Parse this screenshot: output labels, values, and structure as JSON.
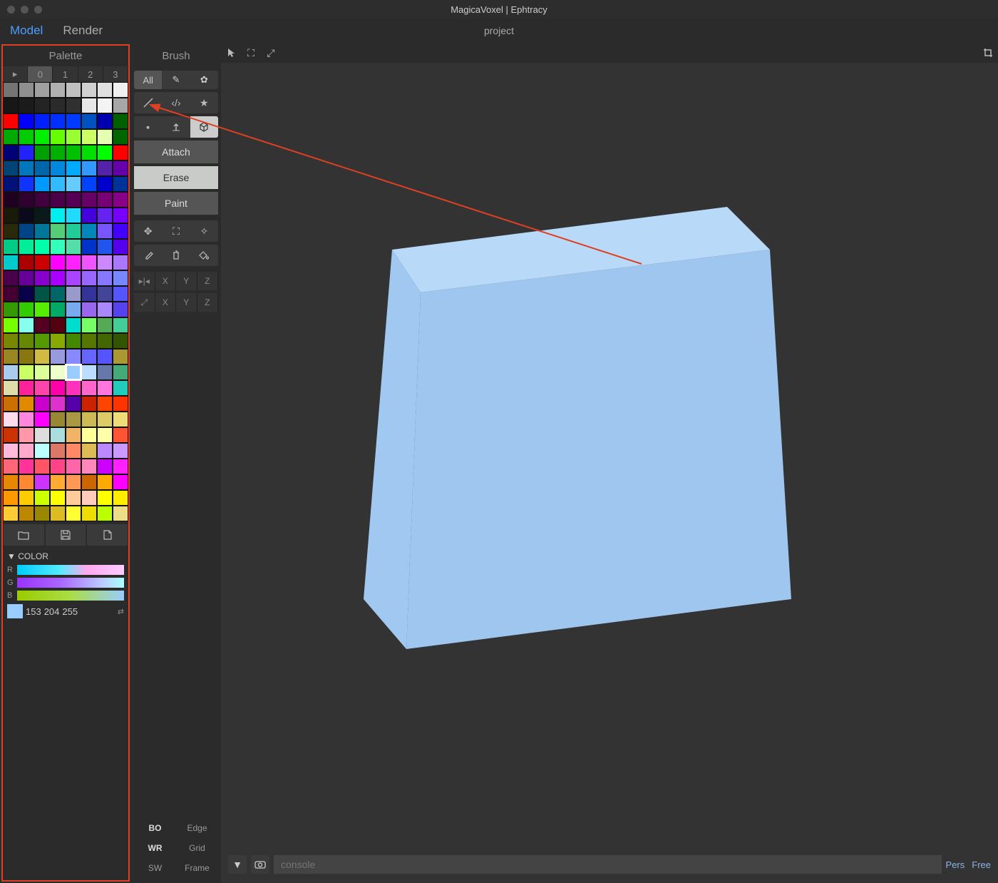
{
  "window": {
    "title": "MagicaVoxel | Ephtracy"
  },
  "menubar": {
    "tabs": [
      "Model",
      "Render"
    ],
    "active": 0,
    "project": "project"
  },
  "palette": {
    "title": "Palette",
    "tabs": [
      "▸",
      "0",
      "1",
      "2",
      "3"
    ],
    "active_tab": 1,
    "swatches": [
      "#747474",
      "#8f8f8f",
      "#a0a0a0",
      "#b0b0b0",
      "#c0c0c0",
      "#d0d0d0",
      "#e0e0e0",
      "#f0f0f0",
      "#171717",
      "#1b1b1b",
      "#242424",
      "#2a2a2a",
      "#303030",
      "#e7e7e7",
      "#f4f4f4",
      "#a7a7a7",
      "#ff0000",
      "#0000ff",
      "#0020ff",
      "#002fff",
      "#003aff",
      "#0052c0",
      "#0000b0",
      "#006000",
      "#00aa00",
      "#00cc00",
      "#00ee00",
      "#66ff00",
      "#99ff33",
      "#ccff66",
      "#e5ffb3",
      "#006600",
      "#000077",
      "#2222ff",
      "#00a000",
      "#00b000",
      "#00c000",
      "#00e000",
      "#00ff00",
      "#ff0000",
      "#004477",
      "#0077bb",
      "#0066aa",
      "#0088dd",
      "#00aaff",
      "#3399ff",
      "#5522aa",
      "#6600aa",
      "#001177",
      "#1133ff",
      "#0099ff",
      "#33bbff",
      "#66ccff",
      "#0044ff",
      "#0000cc",
      "#003399",
      "#200020",
      "#300030",
      "#400040",
      "#4a014a",
      "#550055",
      "#660066",
      "#770077",
      "#880088",
      "#1a1a0a",
      "#0a0a1a",
      "#0a1a1a",
      "#00eeee",
      "#22dafe",
      "#4400dd",
      "#6622ee",
      "#7700ff",
      "#2a2a0a",
      "#004488",
      "#007799",
      "#55cc77",
      "#22cc99",
      "#0088bb",
      "#7755ff",
      "#4400ff",
      "#00cc88",
      "#00ee99",
      "#00ffaa",
      "#33ffbb",
      "#55ddaa",
      "#0033cc",
      "#2255ee",
      "#5500ee",
      "#00cccc",
      "#aa0000",
      "#cc0000",
      "#ff00ff",
      "#ff22ff",
      "#ee55ff",
      "#cc88ff",
      "#aa77ff",
      "#4b004b",
      "#660099",
      "#8800cc",
      "#aa00ff",
      "#aa44ff",
      "#9966ff",
      "#8877ff",
      "#7788ff",
      "#440033",
      "#0a004a",
      "#005544",
      "#006666",
      "#9999cc",
      "#333399",
      "#444499",
      "#5555ff",
      "#339900",
      "#33cc00",
      "#55ee00",
      "#00aa66",
      "#77aaee",
      "#9966ee",
      "#aa88ff",
      "#5544ee",
      "#77ff00",
      "#88ffee",
      "#550022",
      "#550011",
      "#00ddcc",
      "#77ff66",
      "#55aa55",
      "#44cc99",
      "#778800",
      "#668800",
      "#559900",
      "#88aa00",
      "#448800",
      "#557700",
      "#446600",
      "#335500",
      "#998822",
      "#887711",
      "#cfbb44",
      "#9999dd",
      "#8888ff",
      "#6666ff",
      "#5555ff",
      "#aa9933",
      "#aaccee",
      "#ccff66",
      "#ddff99",
      "#eeffcc",
      "#99ccff",
      "#bbddff",
      "#6677aa",
      "#44aa77",
      "#ddddaa",
      "#ff2299",
      "#ff44aa",
      "#ff00aa",
      "#ff33bb",
      "#ff66cc",
      "#ff77dd",
      "#22ccbb",
      "#c97000",
      "#e08a00",
      "#cc00cc",
      "#dd33cc",
      "#5500aa",
      "#cc2200",
      "#ff4400",
      "#ff3300",
      "#ffddee",
      "#ff88dd",
      "#ff00ff",
      "#998833",
      "#aa9944",
      "#ccbb55",
      "#ddcc66",
      "#eedd77",
      "#cc3300",
      "#ff99aa",
      "#dddddd",
      "#aadddd",
      "#efb466",
      "#ffff99",
      "#ffffaa",
      "#ff5533",
      "#ffbbdd",
      "#ffaacc",
      "#bbffff",
      "#dd7766",
      "#ff8866",
      "#ddbb55",
      "#bb88ff",
      "#cc99ff",
      "#ff6677",
      "#ff3399",
      "#ff5566",
      "#ff4488",
      "#ff66aa",
      "#ff88bb",
      "#cc00ff",
      "#ff22ff",
      "#e88700",
      "#ff8833",
      "#cd34ff",
      "#ffaa33",
      "#ff9955",
      "#cc6600",
      "#ffaa00",
      "#ff00ff",
      "#ff9900",
      "#ffcc00",
      "#ccff00",
      "#ffff00",
      "#ffcc99",
      "#ffccbb",
      "#ffff00",
      "#ffee00",
      "#ffcc33",
      "#bb8800",
      "#998800",
      "#ddbb22",
      "#ffff33",
      "#eedd00",
      "#bbff00",
      "#eedd88"
    ],
    "selected_index": 148,
    "actions": {
      "open": "folder-icon",
      "save": "save-icon",
      "file": "file-icon"
    },
    "color": {
      "title": "COLOR",
      "r_label": "R",
      "g_label": "G",
      "b_label": "B",
      "values": [
        "153",
        "204",
        "255"
      ],
      "hex": "#99ccff"
    }
  },
  "brush": {
    "title": "Brush",
    "filter": {
      "all": "All"
    },
    "modes": [
      "Attach",
      "Erase",
      "Paint"
    ],
    "active_mode": 1,
    "axis_labels": [
      "X",
      "Y",
      "Z"
    ],
    "bottom_rows": [
      [
        "BO",
        "Edge"
      ],
      [
        "WR",
        "Grid"
      ],
      [
        "SW",
        "Frame"
      ]
    ]
  },
  "viewport": {
    "console_placeholder": "console",
    "camera": [
      "Pers",
      "Free"
    ]
  }
}
